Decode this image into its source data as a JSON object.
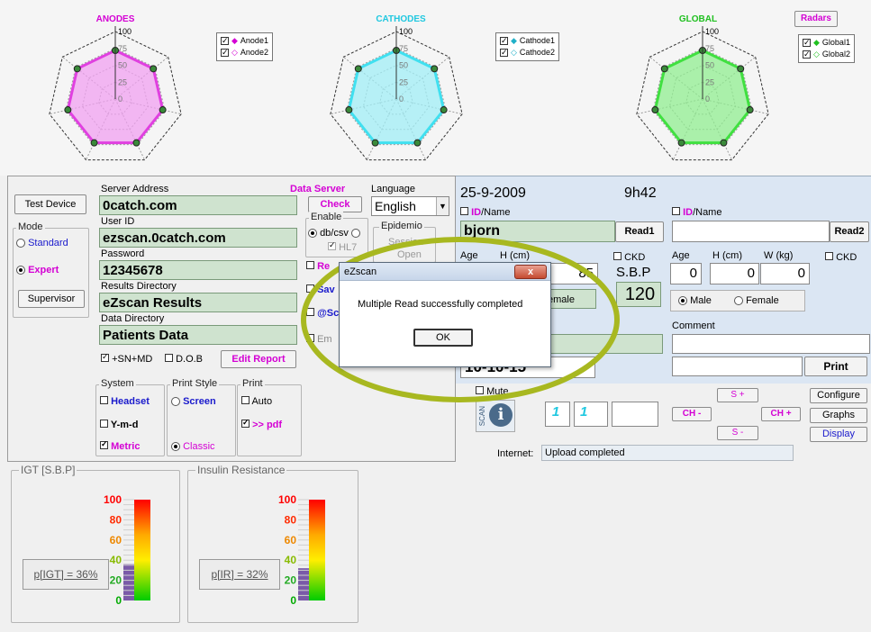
{
  "radars": {
    "anodes": {
      "title": "ANODES",
      "color": "#e040e0",
      "legend": [
        "Anode1",
        "Anode2"
      ]
    },
    "cathodes": {
      "title": "CATHODES",
      "color": "#40e0f0",
      "legend": [
        "Cathode1",
        "Cathode2"
      ]
    },
    "global": {
      "title": "GLOBAL",
      "color": "#40e040",
      "legend": [
        "Global1",
        "Global2"
      ]
    },
    "ticks": [
      "100",
      "75",
      "50",
      "25",
      "0"
    ],
    "radars_button": "Radars"
  },
  "left": {
    "test_device": "Test Device",
    "mode_label": "Mode",
    "standard": "Standard",
    "expert": "Expert",
    "supervisor": "Supervisor",
    "server_address_label": "Server Address",
    "server_address": "0catch.com",
    "data_server": "Data Server",
    "check": "Check",
    "user_id_label": "User ID",
    "user_id": "ezscan.0catch.com",
    "password_label": "Password",
    "password": "12345678",
    "results_dir_label": "Results Directory",
    "results_dir": "eZscan Results",
    "data_dir_label": "Data Directory",
    "data_dir": "Patients Data",
    "language_label": "Language",
    "language": "English",
    "enable_label": "Enable",
    "db_csv": "db/csv",
    "hl7": "HL7",
    "epidemio": "Epidemio",
    "session": "Session",
    "open": "Open",
    "re": "Re",
    "sav": "Sav",
    "at_sc": "@Sc",
    "em": "Em",
    "sn_md": "+SN+MD",
    "dob": "D.O.B",
    "edit_report": "Edit Report",
    "system_label": "System",
    "headset": "Headset",
    "ymd": "Y-m-d",
    "metric": "Metric",
    "print_style_label": "Print Style",
    "screen": "Screen",
    "classic": "Classic",
    "print_label": "Print",
    "auto": "Auto",
    "pdf": ">> pdf"
  },
  "right": {
    "date": "25-9-2009",
    "time": "9h42",
    "id": "ID",
    "name": "/Name",
    "name1": "bjorn",
    "read1": "Read1",
    "read2": "Read2",
    "age": "Age",
    "h_cm": "H (cm)",
    "w_kg": "W (kg)",
    "ckd": "CKD",
    "sbp": "S.B.P",
    "w1": "85",
    "sbp_val": "120",
    "female_left": "emale",
    "age2": "0",
    "h2": "0",
    "w2": "0",
    "male": "Male",
    "female": "Female",
    "comment": "Comment",
    "date_field": "10-10-15",
    "print": "Print",
    "mute": "Mute",
    "scan": "SCAN",
    "ch_minus": "CH -",
    "ch_plus": "CH +",
    "s_plus": "S +",
    "s_minus": "S -",
    "num1": "1",
    "num2": "1",
    "configure": "Configure",
    "graphs": "Graphs",
    "display": "Display",
    "internet": "Internet:",
    "internet_status": "Upload completed"
  },
  "gauges": {
    "igt": {
      "title": "IGT [S.B.P]",
      "result": "p[IGT] = 36%",
      "value": 36
    },
    "ir": {
      "title": "Insulin Resistance",
      "result": "p[IR] = 32%",
      "value": 32
    },
    "ticks": [
      "100",
      "80",
      "60",
      "40",
      "20",
      "0"
    ]
  },
  "dialog": {
    "title": "eZscan",
    "close": "x",
    "message": "Multiple Read successfully completed",
    "ok": "OK"
  },
  "colors": {
    "highlight_ring": "#a8b820",
    "green_field": "#cfe3cf",
    "right_panel": "#dbe6f3"
  }
}
